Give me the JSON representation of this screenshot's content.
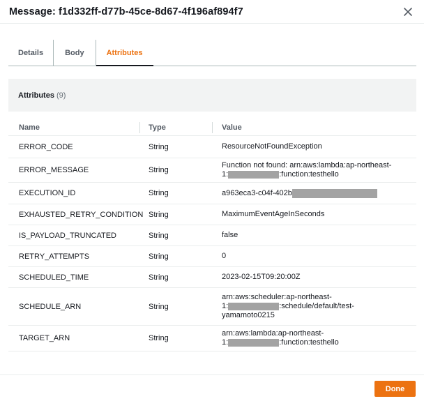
{
  "modal": {
    "title": "Message: f1d332ff-d77b-45ce-8d67-4f196af894f7"
  },
  "tabs": [
    {
      "label": "Details"
    },
    {
      "label": "Body"
    },
    {
      "label": "Attributes"
    }
  ],
  "panel": {
    "title": "Attributes",
    "count": "(9)"
  },
  "table": {
    "headers": {
      "name": "Name",
      "type": "Type",
      "value": "Value"
    },
    "rows": [
      {
        "name": "ERROR_CODE",
        "type": "String",
        "value": "ResourceNotFoundException"
      },
      {
        "name": "ERROR_MESSAGE",
        "type": "String",
        "value_line1": "Function not found: arn:aws:lambda:ap-northeast-",
        "value_line2_pre": "1:",
        "value_line2_post": ":function:testhello"
      },
      {
        "name": "EXECUTION_ID",
        "type": "String",
        "value_pre": "a963eca3-c04f-402b"
      },
      {
        "name": "EXHAUSTED_RETRY_CONDITION",
        "type": "String",
        "value": "MaximumEventAgeInSeconds"
      },
      {
        "name": "IS_PAYLOAD_TRUNCATED",
        "type": "String",
        "value": "false"
      },
      {
        "name": "RETRY_ATTEMPTS",
        "type": "String",
        "value": "0"
      },
      {
        "name": "SCHEDULED_TIME",
        "type": "String",
        "value": "2023-02-15T09:20:00Z"
      },
      {
        "name": "SCHEDULE_ARN",
        "type": "String",
        "value_line1": "arn:aws:scheduler:ap-northeast-",
        "value_line2_pre": "1:",
        "value_line2_post": ":schedule/default/test-",
        "value_line3": "yamamoto0215"
      },
      {
        "name": "TARGET_ARN",
        "type": "String",
        "value_line1": "arn:aws:lambda:ap-northeast-",
        "value_line2_pre": "1:",
        "value_line2_post": ":function:testhello"
      }
    ]
  },
  "footer": {
    "done_label": "Done"
  },
  "colors": {
    "accent": "#ec7211",
    "redaction": "#a3a3a3",
    "header_bg": "#f2f3f3"
  },
  "icons": {
    "close": "close-icon"
  }
}
